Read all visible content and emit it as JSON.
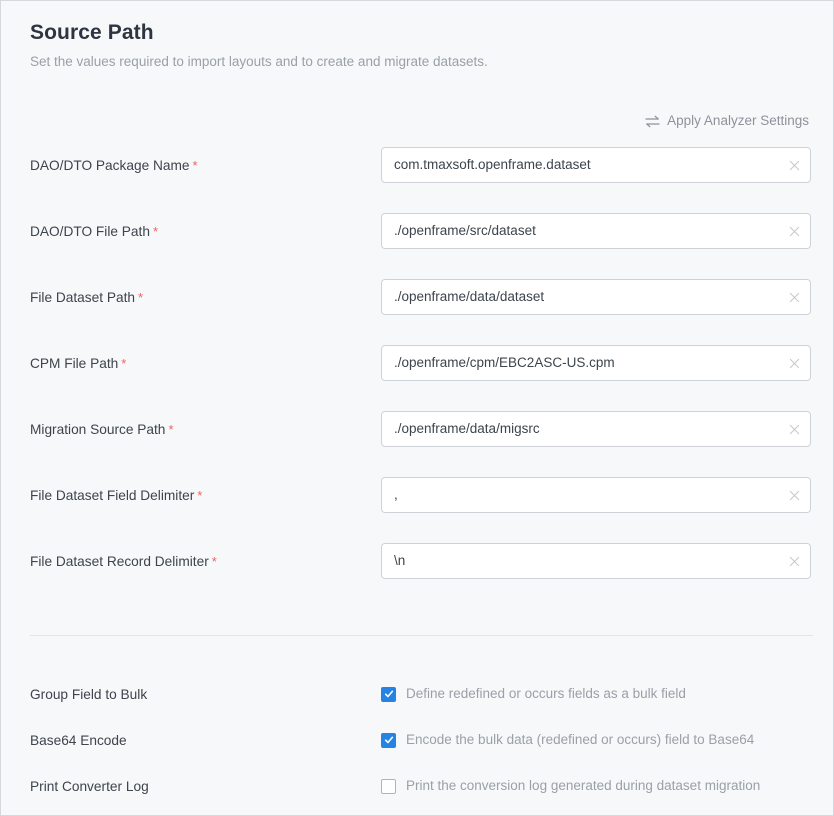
{
  "header": {
    "title": "Source Path",
    "subtitle": "Set the values required to import layouts and to create and migrate datasets."
  },
  "apply_analyzer": {
    "label": "Apply Analyzer Settings",
    "icon": "swap-horizontal-icon"
  },
  "colors": {
    "accent": "#2583e4",
    "required_marker": "#f0625c",
    "background": "#f7f8fa",
    "input_background": "#ffffff",
    "input_border": "#ced2d8",
    "label_text": "#3d444c",
    "muted_text": "#9aa0a8"
  },
  "fields": [
    {
      "label": "DAO/DTO Package Name",
      "required": "*",
      "value": "com.tmaxsoft.openframe.dataset",
      "placeholder": "",
      "clear_icon": "close-icon"
    },
    {
      "label": "DAO/DTO File Path",
      "required": "*",
      "value": "./openframe/src/dataset",
      "placeholder": "",
      "clear_icon": "close-icon"
    },
    {
      "label": "File Dataset Path",
      "required": "*",
      "value": "./openframe/data/dataset",
      "placeholder": "",
      "clear_icon": "close-icon"
    },
    {
      "label": "CPM File Path",
      "required": "*",
      "value": "./openframe/cpm/EBC2ASC-US.cpm",
      "placeholder": "",
      "clear_icon": "close-icon"
    },
    {
      "label": "Migration Source Path",
      "required": "*",
      "value": "./openframe/data/migsrc",
      "placeholder": "",
      "clear_icon": "close-icon"
    },
    {
      "label": "File Dataset Field Delimiter",
      "required": "*",
      "value": ",",
      "placeholder": "",
      "clear_icon": "close-icon"
    },
    {
      "label": "File Dataset Record Delimiter",
      "required": "*",
      "value": "\\n",
      "placeholder": "",
      "clear_icon": "close-icon"
    }
  ],
  "options": [
    {
      "label": "Group Field to Bulk",
      "description": "Define redefined or occurs fields as a bulk field",
      "checked": true
    },
    {
      "label": "Base64 Encode",
      "description": "Encode the bulk data (redefined or occurs) field to Base64",
      "checked": true
    },
    {
      "label": "Print Converter Log",
      "description": "Print the conversion log generated during dataset migration",
      "checked": false
    }
  ]
}
